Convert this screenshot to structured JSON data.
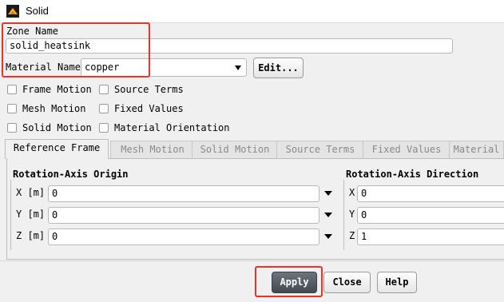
{
  "window": {
    "title": "Solid"
  },
  "zone": {
    "label": "Zone Name",
    "value": "solid_heatsink"
  },
  "material": {
    "label": "Material Name",
    "value": "copper",
    "edit_label": "Edit..."
  },
  "options": [
    {
      "label": "Frame Motion",
      "checked": false
    },
    {
      "label": "Source Terms",
      "checked": false
    },
    {
      "label": "Mesh Motion",
      "checked": false
    },
    {
      "label": "Fixed Values",
      "checked": false
    },
    {
      "label": "Solid Motion",
      "checked": false
    },
    {
      "label": "Material Orientation",
      "checked": false
    }
  ],
  "tabs": [
    {
      "label": "Reference Frame",
      "active": true
    },
    {
      "label": "Mesh Motion",
      "active": false
    },
    {
      "label": "Solid Motion",
      "active": false
    },
    {
      "label": "Source Terms",
      "active": false
    },
    {
      "label": "Fixed Values",
      "active": false
    },
    {
      "label": "Material",
      "active": false
    }
  ],
  "origin": {
    "title": "Rotation-Axis Origin",
    "fields": [
      {
        "label": "X [m]",
        "value": "0"
      },
      {
        "label": "Y [m]",
        "value": "0"
      },
      {
        "label": "Z [m]",
        "value": "0"
      }
    ]
  },
  "direction": {
    "title": "Rotation-Axis Direction",
    "fields": [
      {
        "label": "X",
        "value": "0"
      },
      {
        "label": "Y",
        "value": "0"
      },
      {
        "label": "Z",
        "value": "1"
      }
    ]
  },
  "buttons": {
    "apply": "Apply",
    "close": "Close",
    "help": "Help"
  },
  "colors": {
    "highlight": "#e8322a",
    "apply_bg": "#4a5058"
  }
}
